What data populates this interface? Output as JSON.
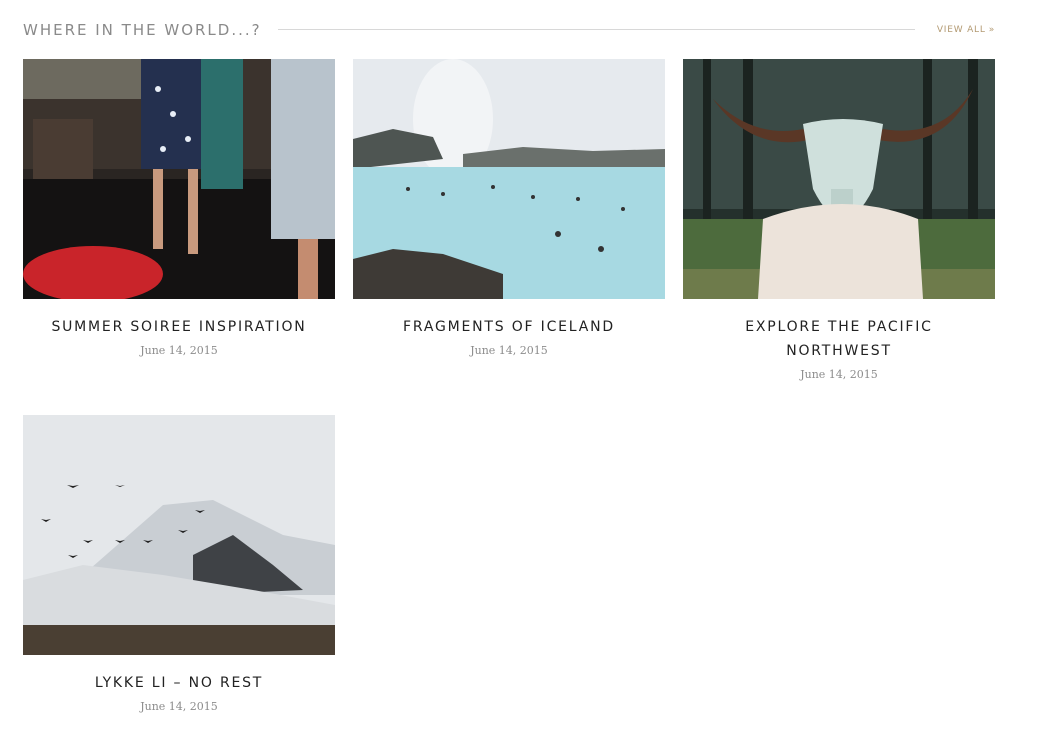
{
  "section": {
    "title": "WHERE IN THE WORLD...?",
    "view_all_label": "VIEW ALL",
    "view_all_icon": "double-chevron-right-icon",
    "accent_color": "#b39a72"
  },
  "posts": [
    {
      "title": "SUMMER SOIREE INSPIRATION",
      "date": "June 14, 2015",
      "image": "party-guests-photo"
    },
    {
      "title": "FRAGMENTS OF ICELAND",
      "date": "June 14, 2015",
      "image": "blue-lagoon-photo"
    },
    {
      "title": "EXPLORE THE PACIFIC NORTHWEST",
      "date": "June 14, 2015",
      "image": "woman-holding-skull-photo"
    },
    {
      "title": "LYKKE LI – NO REST",
      "date": "June 14, 2015",
      "image": "snowy-mountain-birds-photo"
    }
  ]
}
